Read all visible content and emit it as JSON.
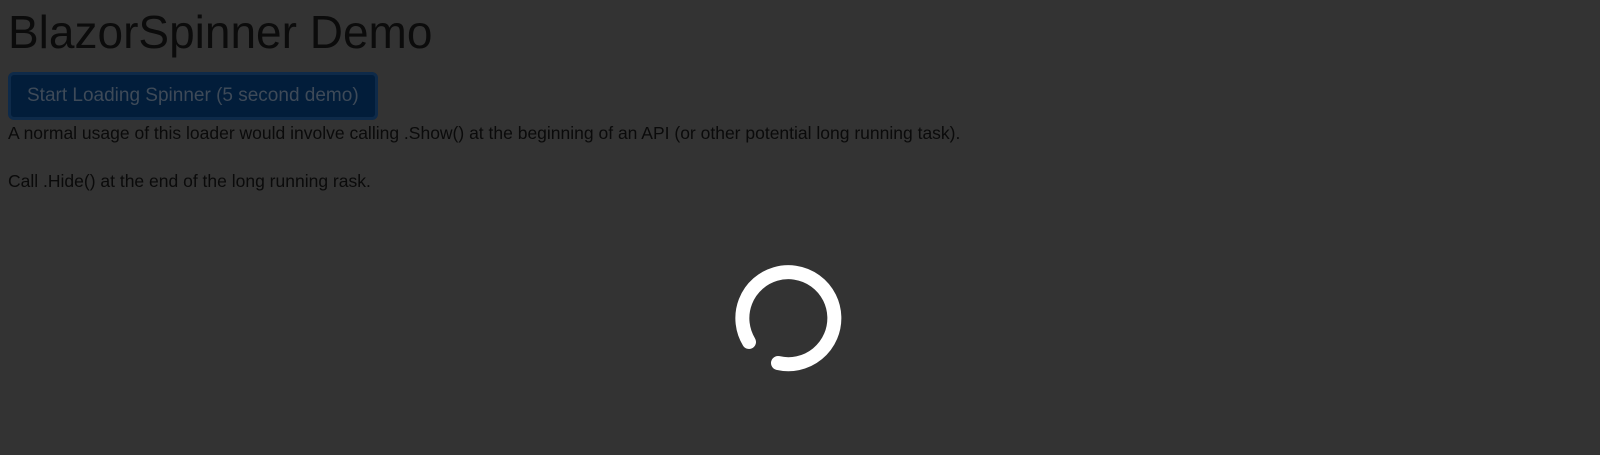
{
  "page": {
    "title": "BlazorSpinner Demo",
    "button_label": "Start Loading Spinner (5 second demo)",
    "paragraphs": [
      "A normal usage of this loader would involve calling .Show() at the beginning of an API (or other potential long running task).",
      "Call .Hide() at the end of the long running rask."
    ]
  },
  "overlay": {
    "background_color": "#333333",
    "spinner_icon": "loading-spinner-icon",
    "spinner_color": "#ffffff"
  },
  "colors": {
    "button_bg": "#021d3a",
    "text": "#0b0b0b"
  }
}
